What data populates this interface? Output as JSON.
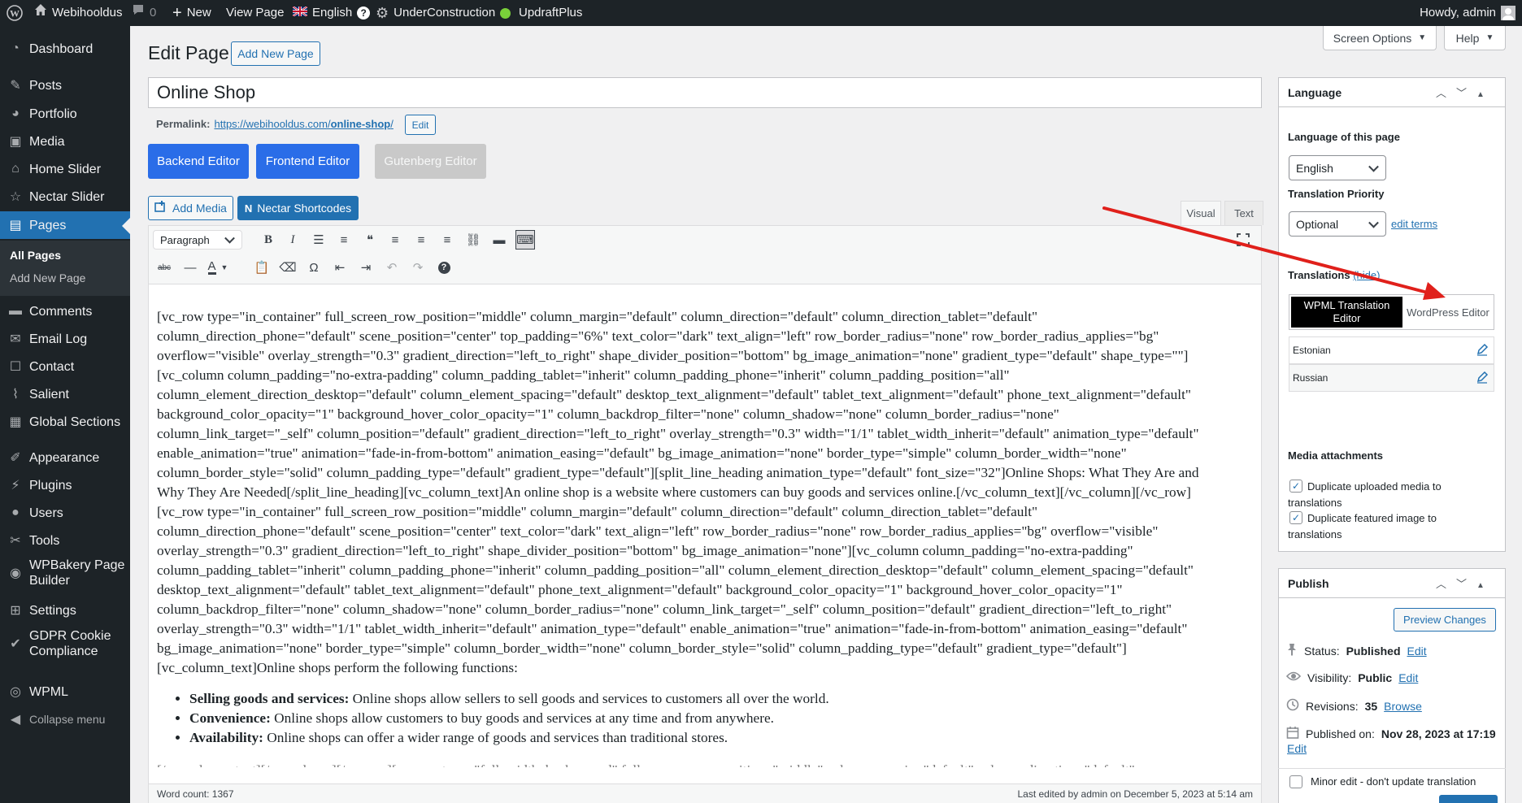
{
  "admin_bar": {
    "site_name": "Webihooldus",
    "comments_count": "0",
    "new_label": "New",
    "view_page": "View Page",
    "language": "English",
    "under_construction": "UnderConstruction",
    "updraft": "UpdraftPlus",
    "howdy": "Howdy, admin"
  },
  "sidebar": {
    "items": [
      {
        "label": "Dashboard",
        "icon": "dashboard-icon"
      },
      {
        "label": "Posts",
        "icon": "pin-icon"
      },
      {
        "label": "Portfolio",
        "icon": "portfolio-icon"
      },
      {
        "label": "Media",
        "icon": "media-icon"
      },
      {
        "label": "Home Slider",
        "icon": "home-icon"
      },
      {
        "label": "Nectar Slider",
        "icon": "star-icon"
      },
      {
        "label": "Pages",
        "icon": "pages-icon"
      },
      {
        "label": "Comments",
        "icon": "comment-icon"
      },
      {
        "label": "Email Log",
        "icon": "email-icon"
      },
      {
        "label": "Contact",
        "icon": "contact-icon"
      },
      {
        "label": "Salient",
        "icon": "salient-icon"
      },
      {
        "label": "Global Sections",
        "icon": "sections-icon"
      },
      {
        "label": "Appearance",
        "icon": "brush-icon"
      },
      {
        "label": "Plugins",
        "icon": "plugin-icon"
      },
      {
        "label": "Users",
        "icon": "user-icon"
      },
      {
        "label": "Tools",
        "icon": "wrench-icon"
      },
      {
        "label": "WPBakery Page Builder",
        "icon": "builder-icon"
      },
      {
        "label": "Settings",
        "icon": "settings-icon"
      },
      {
        "label": "GDPR Cookie Compliance",
        "icon": "gdpr-icon"
      },
      {
        "label": "WPML",
        "icon": "wpml-icon"
      },
      {
        "label": "Collapse menu",
        "icon": "collapse-icon"
      }
    ],
    "sub_all_pages": "All Pages",
    "sub_add_new": "Add New Page"
  },
  "header": {
    "title": "Edit Page",
    "add_new": "Add New Page",
    "screen_options": "Screen Options",
    "help": "Help"
  },
  "editor": {
    "page_title": "Online Shop",
    "permalink_label": "Permalink:",
    "permalink_base": "https://webihooldus.com/",
    "permalink_slug": "online-shop",
    "permalink_end": "/",
    "permalink_edit": "Edit",
    "backend_editor": "Backend Editor",
    "frontend_editor": "Frontend Editor",
    "gutenberg_editor": "Gutenberg Editor",
    "add_media": "Add Media",
    "nectar_shortcodes": "Nectar Shortcodes",
    "tab_visual": "Visual",
    "tab_text": "Text",
    "format_select": "Paragraph",
    "content_lines": [
      "[vc_row type=\"in_container\" full_screen_row_position=\"middle\" column_margin=\"default\" column_direction=\"default\" column_direction_tablet=\"default\"",
      "column_direction_phone=\"default\" scene_position=\"center\" top_padding=\"6%\" text_color=\"dark\" text_align=\"left\" row_border_radius=\"none\" row_border_radius_applies=\"bg\"",
      "overflow=\"visible\" overlay_strength=\"0.3\" gradient_direction=\"left_to_right\" shape_divider_position=\"bottom\" bg_image_animation=\"none\" gradient_type=\"default\" shape_type=\"\"]",
      "[vc_column column_padding=\"no-extra-padding\" column_padding_tablet=\"inherit\" column_padding_phone=\"inherit\" column_padding_position=\"all\"",
      "column_element_direction_desktop=\"default\" column_element_spacing=\"default\" desktop_text_alignment=\"default\" tablet_text_alignment=\"default\" phone_text_alignment=\"default\"",
      "background_color_opacity=\"1\" background_hover_color_opacity=\"1\" column_backdrop_filter=\"none\" column_shadow=\"none\" column_border_radius=\"none\"",
      "column_link_target=\"_self\" column_position=\"default\" gradient_direction=\"left_to_right\" overlay_strength=\"0.3\" width=\"1/1\" tablet_width_inherit=\"default\" animation_type=\"default\"",
      "enable_animation=\"true\" animation=\"fade-in-from-bottom\" animation_easing=\"default\" bg_image_animation=\"none\" border_type=\"simple\" column_border_width=\"none\"",
      "column_border_style=\"solid\" column_padding_type=\"default\" gradient_type=\"default\"][split_line_heading animation_type=\"default\" font_size=\"32\"]Online Shops: What They Are and",
      "Why They Are Needed[/split_line_heading][vc_column_text]An online shop is a website where customers can buy goods and services online.[/vc_column_text][/vc_column][/vc_row]",
      "[vc_row type=\"in_container\" full_screen_row_position=\"middle\" column_margin=\"default\" column_direction=\"default\" column_direction_tablet=\"default\"",
      "column_direction_phone=\"default\" scene_position=\"center\" text_color=\"dark\" text_align=\"left\" row_border_radius=\"none\" row_border_radius_applies=\"bg\" overflow=\"visible\"",
      "overlay_strength=\"0.3\" gradient_direction=\"left_to_right\" shape_divider_position=\"bottom\" bg_image_animation=\"none\"][vc_column column_padding=\"no-extra-padding\"",
      "column_padding_tablet=\"inherit\" column_padding_phone=\"inherit\" column_padding_position=\"all\" column_element_direction_desktop=\"default\" column_element_spacing=\"default\"",
      "desktop_text_alignment=\"default\" tablet_text_alignment=\"default\" phone_text_alignment=\"default\" background_color_opacity=\"1\" background_hover_color_opacity=\"1\"",
      "column_backdrop_filter=\"none\" column_shadow=\"none\" column_border_radius=\"none\" column_link_target=\"_self\" column_position=\"default\" gradient_direction=\"left_to_right\"",
      "overlay_strength=\"0.3\" width=\"1/1\" tablet_width_inherit=\"default\" animation_type=\"default\" enable_animation=\"true\" animation=\"fade-in-from-bottom\" animation_easing=\"default\"",
      "bg_image_animation=\"none\" border_type=\"simple\" column_border_width=\"none\" column_border_style=\"solid\" column_padding_type=\"default\" gradient_type=\"default\"]",
      "[vc_column_text]Online shops perform the following functions:"
    ],
    "bullets": [
      {
        "bold": "Selling goods and services:",
        "text": " Online shops allow sellers to sell goods and services to customers all over the world."
      },
      {
        "bold": "Convenience:",
        "text": " Online shops allow customers to buy goods and services at any time and from anywhere."
      },
      {
        "bold": "Availability:",
        "text": " Online shops can offer a wider range of goods and services than traditional stores."
      }
    ],
    "word_count": "Word count: 1367",
    "last_edited": "Last edited by admin on December 5, 2023 at 5:14 am"
  },
  "language_box": {
    "title": "Language",
    "language_of_page": "Language of this page",
    "language_value": "English",
    "translation_priority": "Translation Priority",
    "priority_value": "Optional",
    "edit_terms": "edit terms",
    "translations_label": "Translations",
    "hide": "(hide)",
    "wpml_editor": "WPML Translation Editor",
    "wp_editor": "WordPress Editor",
    "languages": [
      "Estonian",
      "Russian"
    ],
    "media_attachments": "Media attachments",
    "dup_media": "Duplicate uploaded media to translations",
    "dup_featured": "Duplicate featured image to translations"
  },
  "publish_box": {
    "title": "Publish",
    "preview": "Preview Changes",
    "status_label": "Status:",
    "status_value": "Published",
    "visibility_label": "Visibility:",
    "visibility_value": "Public",
    "revisions_label": "Revisions:",
    "revisions_value": "35",
    "browse": "Browse",
    "published_on_label": "Published on:",
    "published_on_value": "Nov 28, 2023 at 17:19",
    "edit": "Edit",
    "minor_edit": "Minor edit - don't update translation"
  },
  "colors": {
    "admin_dark": "#1d2327",
    "accent": "#2271b1",
    "builder_blue": "#2a6de8",
    "annotation_arrow": "#e0201b"
  }
}
